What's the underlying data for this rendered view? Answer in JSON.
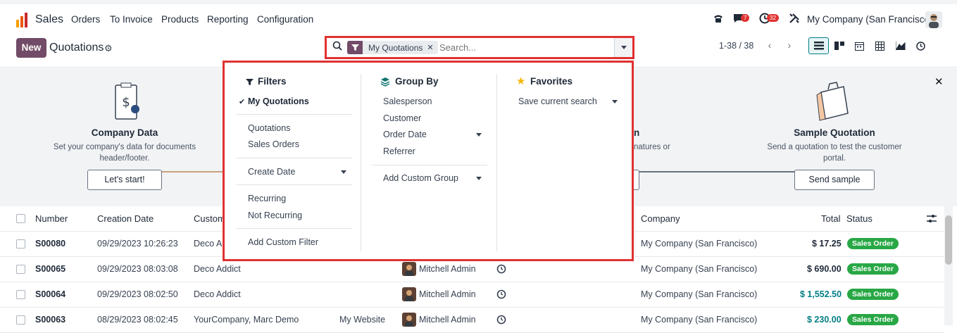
{
  "topnav": {
    "app_name": "Sales",
    "menu": [
      "Orders",
      "To Invoice",
      "Products",
      "Reporting",
      "Configuration"
    ],
    "chat_badge": "7",
    "activity_badge": "32",
    "company": "My Company (San Francisco)"
  },
  "control_panel": {
    "new_label": "New",
    "title": "Quotations",
    "pager": "1-38 / 38"
  },
  "search": {
    "facet": "My Quotations",
    "placeholder": "Search..."
  },
  "dropdown": {
    "filters": {
      "title": "Filters",
      "checked_item": "My Quotations",
      "group1": [
        "Quotations",
        "Sales Orders"
      ],
      "create_date": "Create Date",
      "group2": [
        "Recurring",
        "Not Recurring"
      ],
      "add_custom": "Add Custom Filter"
    },
    "group_by": {
      "title": "Group By",
      "items": [
        "Salesperson",
        "Customer",
        "Order Date",
        "Referrer"
      ],
      "add_custom": "Add Custom Group"
    },
    "favorites": {
      "title": "Favorites",
      "save": "Save current search"
    }
  },
  "onboarding": {
    "step1": {
      "title": "Company Data",
      "desc_line1": "Set your company's data for documents",
      "desc_line2": "header/footer.",
      "button": "Let's start!"
    },
    "step3_partial": {
      "title": "n",
      "desc": "natures or"
    },
    "step4": {
      "title": "Sample Quotation",
      "desc_line1": "Send a quotation to test the customer",
      "desc_line2": "portal.",
      "button": "Send sample"
    }
  },
  "table": {
    "headers": {
      "number": "Number",
      "creation_date": "Creation Date",
      "customer": "Custom",
      "company": "Company",
      "total": "Total",
      "status": "Status"
    },
    "rows": [
      {
        "number": "S00080",
        "date": "09/29/2023 10:26:23",
        "customer": "Deco A",
        "website": "",
        "salesperson": "",
        "company": "My Company (San Francisco)",
        "total": "$ 17.25",
        "status": "Sales Order"
      },
      {
        "number": "S00065",
        "date": "09/29/2023 08:03:08",
        "customer": "Deco Addict",
        "website": "",
        "salesperson": "Mitchell Admin",
        "company": "My Company (San Francisco)",
        "total": "$ 690.00",
        "status": "Sales Order"
      },
      {
        "number": "S00064",
        "date": "09/29/2023 08:02:50",
        "customer": "Deco Addict",
        "website": "",
        "salesperson": "Mitchell Admin",
        "company": "My Company (San Francisco)",
        "total": "$ 1,552.50",
        "status": "Sales Order"
      },
      {
        "number": "S00063",
        "date": "08/29/2023 08:02:45",
        "customer": "YourCompany, Marc Demo",
        "website": "My Website",
        "salesperson": "Mitchell Admin",
        "company": "My Company (San Francisco)",
        "total": "$ 230.00",
        "status": "Sales Order"
      }
    ]
  },
  "colors": {
    "brand": "#714b67",
    "highlight_box": "#e03131",
    "status_green": "#28a745",
    "teal_total": "#017e84"
  }
}
